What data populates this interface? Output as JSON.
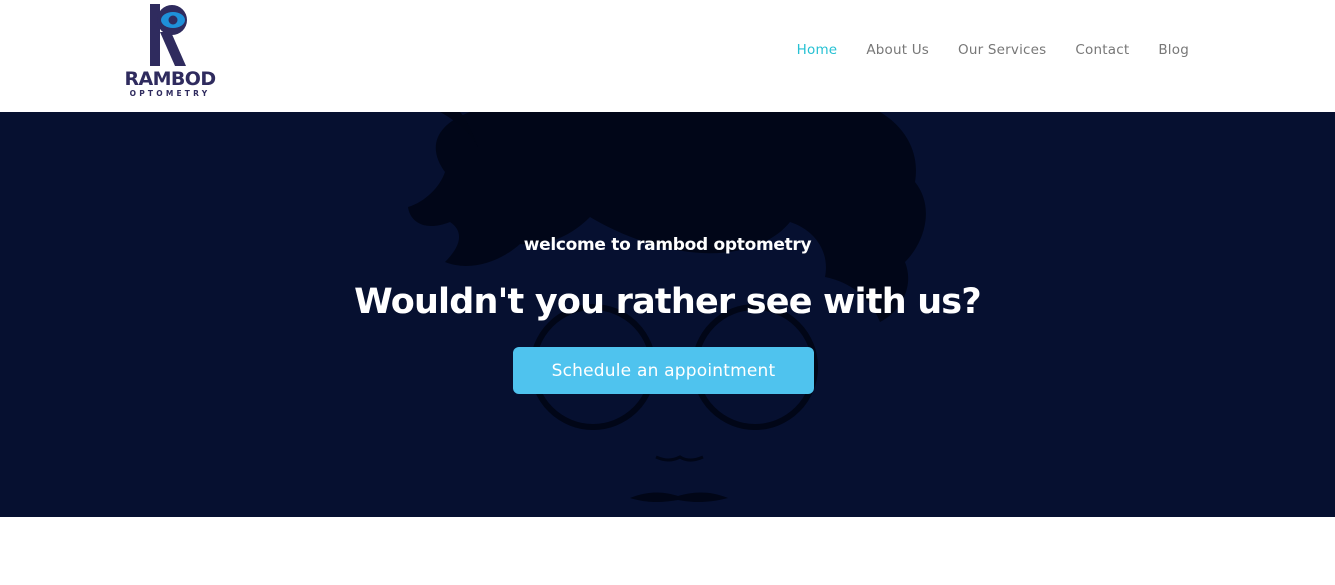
{
  "brand": {
    "name": "RAMBOD",
    "tagline": "OPTOMETRY",
    "colors": {
      "primary": "#2f2b5e",
      "eye": "#1e90d9"
    }
  },
  "nav": {
    "items": [
      {
        "label": "Home",
        "active": true
      },
      {
        "label": "About Us",
        "active": false
      },
      {
        "label": "Our Services",
        "active": false
      },
      {
        "label": "Contact",
        "active": false
      },
      {
        "label": "Blog",
        "active": false
      }
    ],
    "active_color": "#27c1d3"
  },
  "hero": {
    "eyebrow": "welcome to rambod optometry",
    "headline": "Wouldn't you rather see with us?",
    "cta_label": "Schedule an appointment",
    "background_color": "#061030",
    "cta_color": "#4fc3ee"
  }
}
